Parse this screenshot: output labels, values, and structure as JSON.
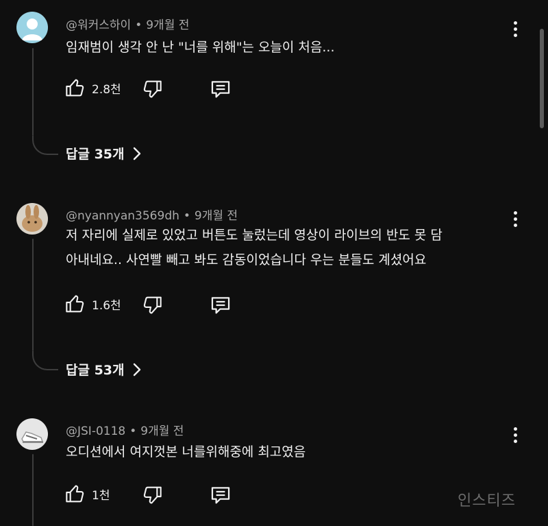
{
  "comments": [
    {
      "author": "@워커스하이",
      "time": "9개월 전",
      "lines": [
        "임재범이 생각 안 난 \"너를 위해\"는 오늘이 처음..."
      ],
      "likes": "2.8천",
      "replies": "답글 35개"
    },
    {
      "author": "@nyannyan3569dh",
      "time": "9개월 전",
      "lines": [
        "저 자리에 실제로 있었고 버튼도 눌렀는데 영상이 라이브의 반도 못 담",
        "아내네요.. 사연빨 빼고 봐도 감동이었습니다 우는 분들도 계셨어요"
      ],
      "likes": "1.6천",
      "replies": "답글 53개"
    },
    {
      "author": "@JSI-0118",
      "time": "9개월 전",
      "lines": [
        "오디션에서 여지껏본 너를위해중에 최고였음"
      ],
      "likes": "1천"
    }
  ],
  "separator": "•",
  "icons": [
    "like-icon",
    "dislike-icon",
    "reply-icon",
    "more-vert-icon",
    "chevron-right-icon"
  ],
  "watermark": "인스티즈",
  "colors": {
    "background": "#0f0f0f",
    "text": "#f1f1f1",
    "meta": "#aaaaaa",
    "line": "#3d3d3d"
  }
}
